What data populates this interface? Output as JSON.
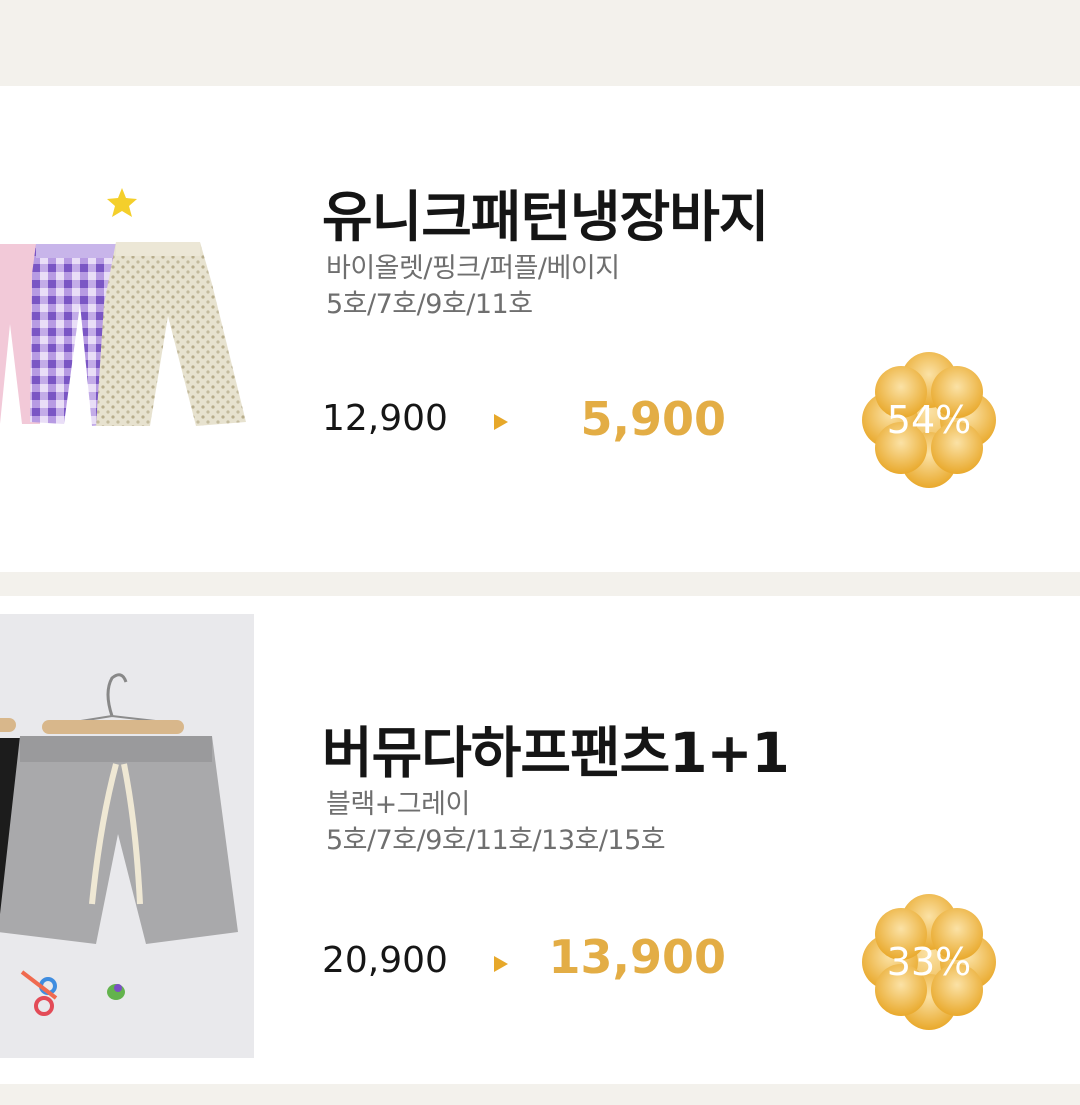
{
  "products": [
    {
      "name": "유니크패턴냉장바지",
      "colors": "바이올렛/핑크/퍼플/베이지",
      "sizes": "5호/7호/9호/11호",
      "original_price": "12,900",
      "sale_price": "5,900",
      "discount": "54%",
      "image_icon": "pants-photo"
    },
    {
      "name": "버뮤다하프팬츠1+1",
      "colors": "블랙+그레이",
      "sizes": "5호/7호/9호/11호/13호/15호",
      "original_price": "20,900",
      "sale_price": "13,900",
      "discount": "33%",
      "image_icon": "shorts-photo"
    }
  ],
  "colors": {
    "page_bg": "#f3f1ec",
    "card_bg": "#ffffff",
    "sale_price": "#e3ad45",
    "arrow": "#e7a82a",
    "badge_light": "#f8d88c",
    "badge_dark": "#e9a92c"
  }
}
